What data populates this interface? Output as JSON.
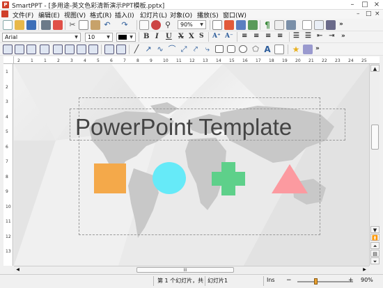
{
  "window": {
    "title": "SmartPPT - [多用途-英文色彩清新演示PPT模板.pptx]",
    "buttons": [
      "–",
      "□",
      "×"
    ]
  },
  "menu": {
    "items": [
      "文件(F)",
      "编辑(E)",
      "视图(V)",
      "格式(R)",
      "插入(I)",
      "幻灯片(L)",
      "对象(O)",
      "播放(S)",
      "窗口(W)"
    ],
    "doc_buttons": [
      "–",
      "□",
      "×"
    ]
  },
  "toolbar1": {
    "zoom_value": "90%",
    "more": "»"
  },
  "toolbar2": {
    "font_name": "Arial",
    "font_size": "10",
    "more": "»"
  },
  "toolbar3": {
    "more": "»"
  },
  "rulers": {
    "horizontal": [
      "2",
      "1",
      "1",
      "2",
      "3",
      "4",
      "5",
      "6",
      "7",
      "8",
      "9",
      "10",
      "11",
      "12",
      "13",
      "14",
      "15",
      "16",
      "17",
      "18",
      "19",
      "20",
      "21",
      "22",
      "23",
      "24",
      "25"
    ],
    "vertical": [
      "1",
      "2",
      "3",
      "4",
      "5",
      "6",
      "7",
      "8",
      "9",
      "10",
      "11",
      "12",
      "13"
    ]
  },
  "slide": {
    "title": "PowerPoint Template",
    "shape_colors": {
      "square": "#f4a94a",
      "circle": "#66eaf8",
      "cross": "#5ed08a",
      "triangle": "#fc9aa0",
      "map": "#c8c8c8"
    }
  },
  "hscroll": {
    "thumb_label": "III"
  },
  "status": {
    "slide_info": "第 1 个幻灯片，共",
    "slide_name": "幻灯片1",
    "mode": "Ins",
    "zoom": "90%"
  },
  "colors": {
    "accent": "#d0402a",
    "font_color": "#000000"
  }
}
